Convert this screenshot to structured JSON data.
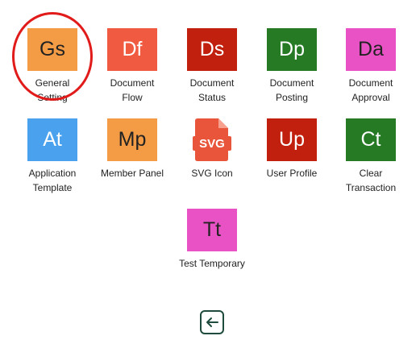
{
  "modules": [
    {
      "abbr": "Gs",
      "label": "General\nSetting",
      "bg": "#f39c45",
      "fg": "#222222",
      "highlighted": true
    },
    {
      "abbr": "Df",
      "label": "Document\nFlow",
      "bg": "#f05a40",
      "fg": "#ffffff"
    },
    {
      "abbr": "Ds",
      "label": "Document\nStatus",
      "bg": "#c1200e",
      "fg": "#ffffff"
    },
    {
      "abbr": "Dp",
      "label": "Document\nPosting",
      "bg": "#257a23",
      "fg": "#ffffff"
    },
    {
      "abbr": "Da",
      "label": "Document\nApproval",
      "bg": "#e852c4",
      "fg": "#222222"
    },
    {
      "abbr": "At",
      "label": "Application\nTemplate",
      "bg": "#4aa2ee",
      "fg": "#ffffff"
    },
    {
      "abbr": "Mp",
      "label": "Member Panel",
      "bg": "#f39c45",
      "fg": "#222222"
    },
    {
      "abbr": "SVG",
      "label": "SVG Icon",
      "bg": "#e8553a",
      "fg": "#ffffff",
      "icon": "svg-file-icon"
    },
    {
      "abbr": "Up",
      "label": "User Profile",
      "bg": "#c1200e",
      "fg": "#ffffff"
    },
    {
      "abbr": "Ct",
      "label": "Clear\nTransaction",
      "bg": "#257a23",
      "fg": "#ffffff"
    },
    {
      "abbr": "Tt",
      "label": "Test Temporary",
      "bg": "#e852c4",
      "fg": "#222222"
    }
  ],
  "highlight_color": "#e11a1a",
  "back_button": {
    "icon": "arrow-left-icon",
    "color": "#1f4a3e"
  }
}
